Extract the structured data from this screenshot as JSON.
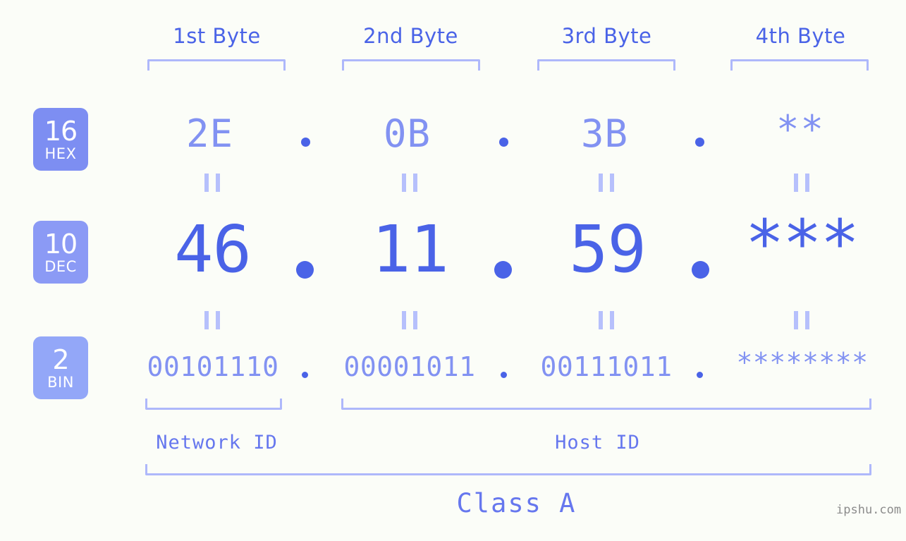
{
  "background_color": "#fbfdf8",
  "accent_color": "#4a63e7",
  "accent_light_color": "#8292f2",
  "bracket_color": "#aeb8fb",
  "columns": [
    {
      "header": "1st Byte"
    },
    {
      "header": "2nd Byte"
    },
    {
      "header": "3rd Byte"
    },
    {
      "header": "4th Byte"
    }
  ],
  "bases": [
    {
      "num": "16",
      "abbr": "HEX",
      "color": "#7d8ef2"
    },
    {
      "num": "10",
      "abbr": "DEC",
      "color": "#8b9af5"
    },
    {
      "num": "2",
      "abbr": "BIN",
      "color": "#93a7f8"
    }
  ],
  "rows": {
    "hex": {
      "values": [
        "2E",
        "0B",
        "3B",
        "**"
      ],
      "separator": "."
    },
    "dec": {
      "values": [
        "46",
        "11",
        "59",
        "***"
      ],
      "separator": "."
    },
    "bin": {
      "values": [
        "00101110",
        "00001011",
        "00111011",
        "********"
      ],
      "separator": "."
    }
  },
  "equals_symbol": "=",
  "id_labels": {
    "network": "Network ID",
    "host": "Host ID"
  },
  "class_label": "Class A",
  "watermark": "ipshu.com"
}
